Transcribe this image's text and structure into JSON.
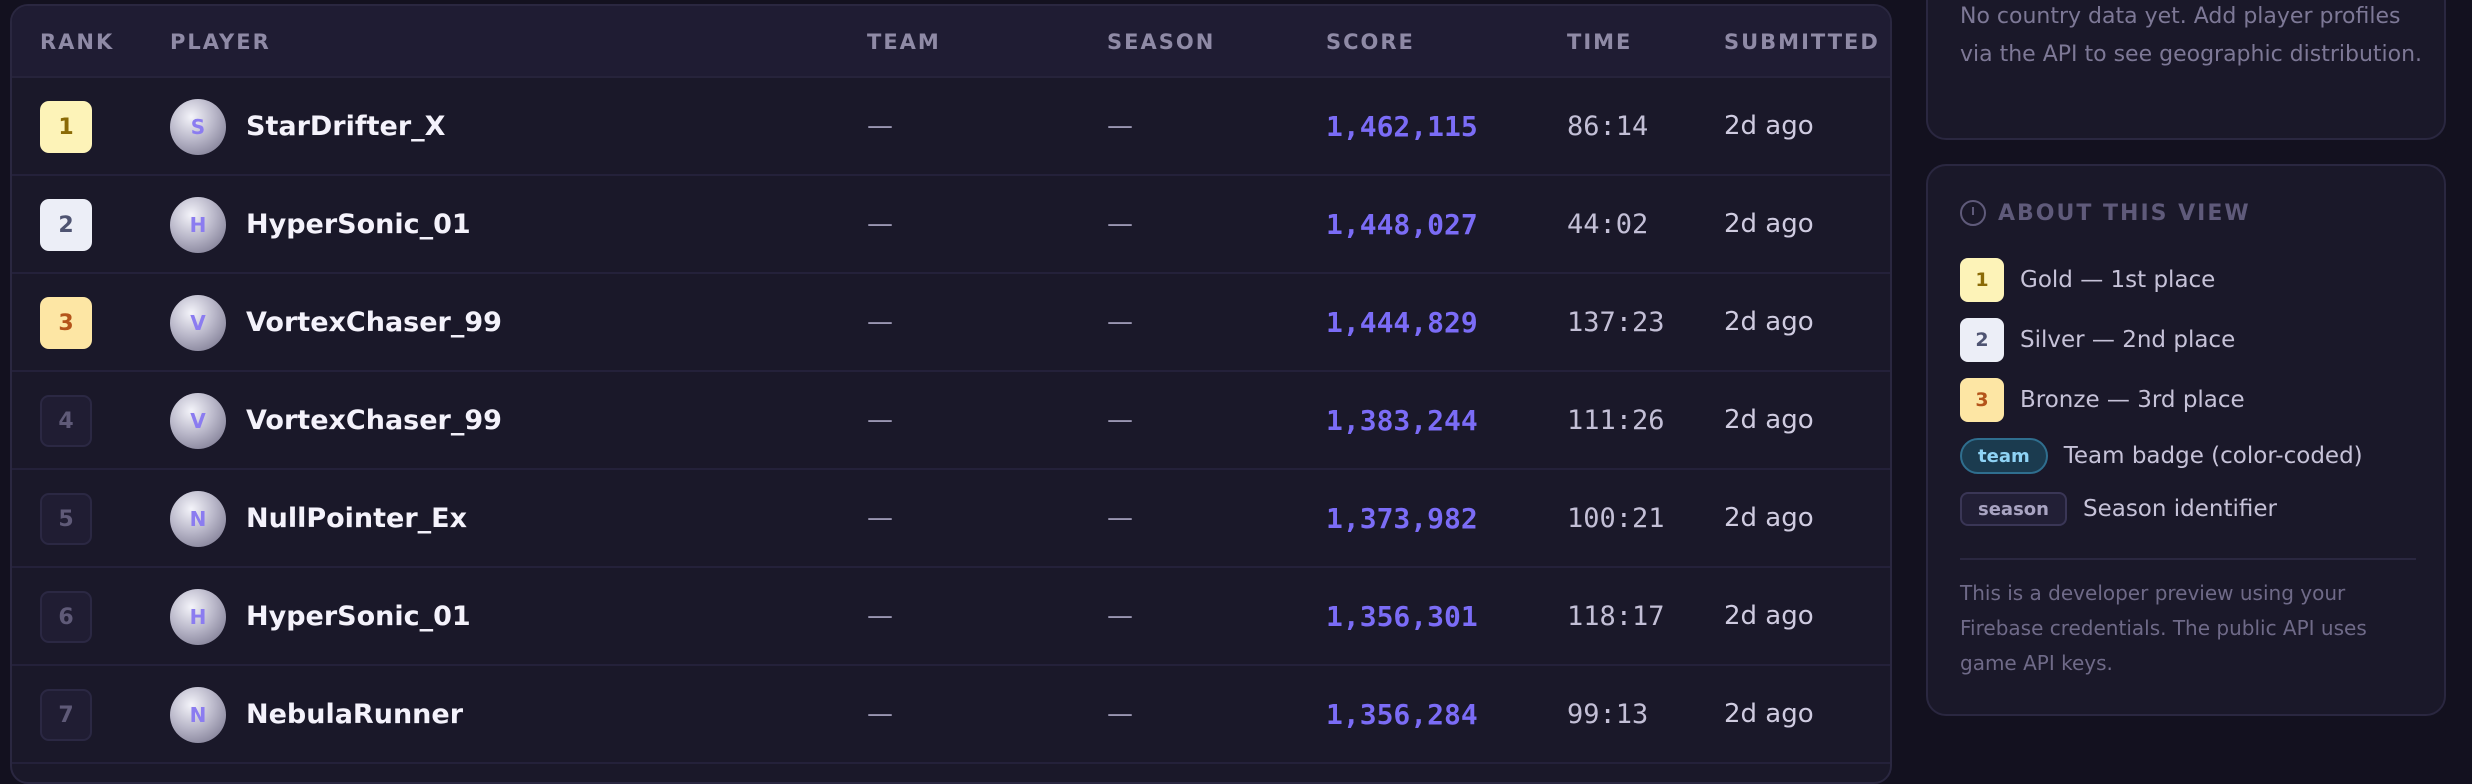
{
  "table": {
    "headers": {
      "rank": "RANK",
      "player": "PLAYER",
      "team": "TEAM",
      "season": "SEASON",
      "score": "SCORE",
      "time": "TIME",
      "submitted": "SUBMITTED"
    },
    "rows": [
      {
        "rank": "1",
        "initial": "S",
        "player": "StarDrifter_X",
        "team": "—",
        "season": "—",
        "score": "1,462,115",
        "time": "86:14",
        "submitted": "2d ago"
      },
      {
        "rank": "2",
        "initial": "H",
        "player": "HyperSonic_01",
        "team": "—",
        "season": "—",
        "score": "1,448,027",
        "time": "44:02",
        "submitted": "2d ago"
      },
      {
        "rank": "3",
        "initial": "V",
        "player": "VortexChaser_99",
        "team": "—",
        "season": "—",
        "score": "1,444,829",
        "time": "137:23",
        "submitted": "2d ago"
      },
      {
        "rank": "4",
        "initial": "V",
        "player": "VortexChaser_99",
        "team": "—",
        "season": "—",
        "score": "1,383,244",
        "time": "111:26",
        "submitted": "2d ago"
      },
      {
        "rank": "5",
        "initial": "N",
        "player": "NullPointer_Ex",
        "team": "—",
        "season": "—",
        "score": "1,373,982",
        "time": "100:21",
        "submitted": "2d ago"
      },
      {
        "rank": "6",
        "initial": "H",
        "player": "HyperSonic_01",
        "team": "—",
        "season": "—",
        "score": "1,356,301",
        "time": "118:17",
        "submitted": "2d ago"
      },
      {
        "rank": "7",
        "initial": "N",
        "player": "NebulaRunner",
        "team": "—",
        "season": "—",
        "score": "1,356,284",
        "time": "99:13",
        "submitted": "2d ago"
      }
    ]
  },
  "geo_card": {
    "message": "No country data yet. Add player profiles via the API to see geographic distribution."
  },
  "about": {
    "title": "ABOUT THIS VIEW",
    "gold": {
      "badge": "1",
      "label": "Gold — 1st place"
    },
    "silver": {
      "badge": "2",
      "label": "Silver — 2nd place"
    },
    "bronze": {
      "badge": "3",
      "label": "Bronze — 3rd place"
    },
    "team": {
      "pill": "team",
      "label": "Team badge (color-coded)"
    },
    "season": {
      "pill": "season",
      "label": "Season identifier"
    },
    "note": "This is a developer preview using your Firebase credentials. The public API uses game API keys."
  },
  "colors": {
    "background": "#13111f",
    "panel": "#1a1829",
    "score_accent": "#7b6cf6",
    "gold": "#fdf3b8",
    "silver": "#eceef7",
    "bronze": "#fde6a4"
  },
  "icons": {
    "about": "clock-icon"
  }
}
